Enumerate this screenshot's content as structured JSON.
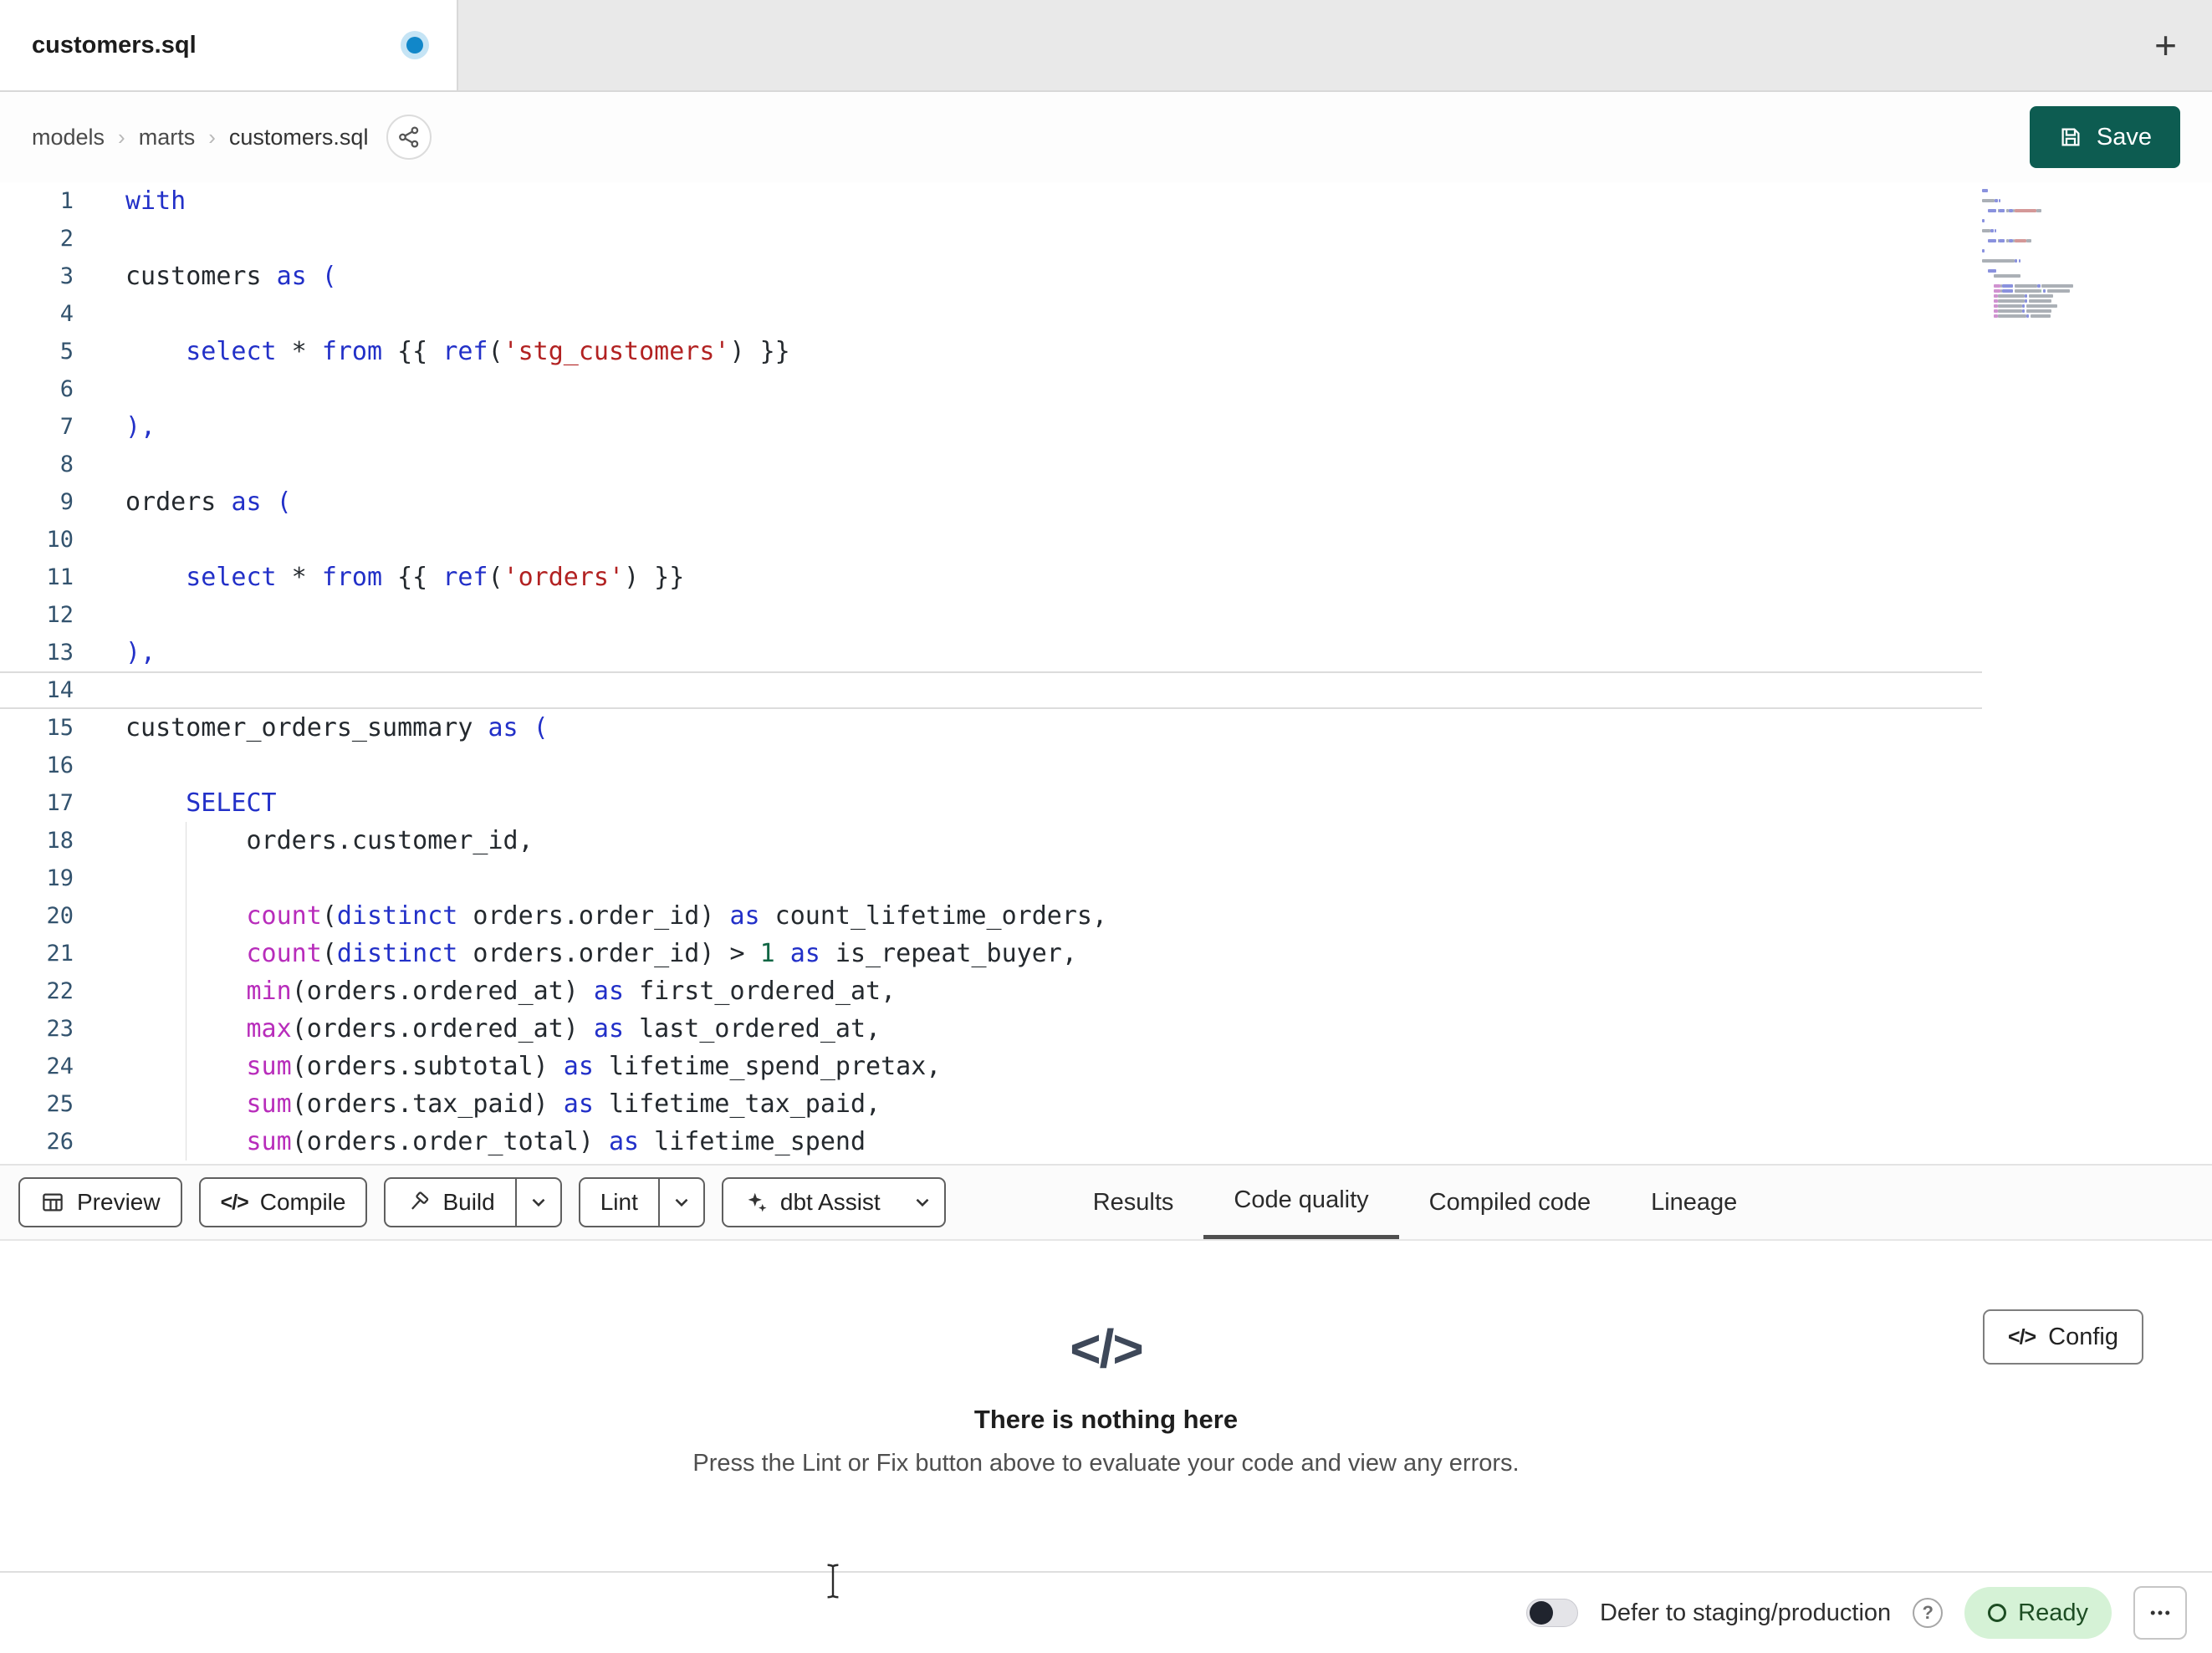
{
  "window": {
    "new_tab_label": "+"
  },
  "tab": {
    "title": "customers.sql",
    "modified": true
  },
  "breadcrumb": {
    "items": [
      "models",
      "marts",
      "customers.sql"
    ],
    "separator": "›"
  },
  "save_button": {
    "label": "Save"
  },
  "colors": {
    "accent": "#0d5c51",
    "keyword": "#2230c8",
    "function": "#b82dbb",
    "string": "#b22222",
    "number": "#116644",
    "text": "#24292e",
    "line_number": "#33536e",
    "ready_bg": "#d5f2d6",
    "ready_text": "#1d4d23"
  },
  "icons": {
    "code_glyph": "</>",
    "tab_modified": "blue-dot",
    "new_tab": "plus",
    "breadcrumb_action": "lineage-dag",
    "save": "floppy-disk",
    "preview": "table-grid",
    "compile": "code-brackets",
    "build": "hammer",
    "dropdown": "chevron-down",
    "dbt_assist": "sparkle",
    "config": "code-brackets",
    "help": "question-circle",
    "ready": "circle-outline",
    "more": "ellipsis",
    "cursor": "i-beam"
  },
  "editor": {
    "active_line": 14,
    "lines": [
      {
        "n": 1,
        "t": [
          [
            "kw",
            "with"
          ]
        ]
      },
      {
        "n": 2,
        "t": []
      },
      {
        "n": 3,
        "t": [
          [
            "tx",
            "customers "
          ],
          [
            "kw",
            "as"
          ],
          [
            "kw",
            " ("
          ]
        ]
      },
      {
        "n": 4,
        "t": []
      },
      {
        "n": 5,
        "t": [
          [
            "tx",
            "    "
          ],
          [
            "kw",
            "select"
          ],
          [
            "tx",
            " * "
          ],
          [
            "kw",
            "from"
          ],
          [
            "tx",
            " {{ "
          ],
          [
            "kw",
            "ref"
          ],
          [
            "tx",
            "("
          ],
          [
            "st",
            "'stg_customers'"
          ],
          [
            "tx",
            ") }}"
          ]
        ]
      },
      {
        "n": 6,
        "t": []
      },
      {
        "n": 7,
        "t": [
          [
            "kw",
            "),"
          ]
        ]
      },
      {
        "n": 8,
        "t": []
      },
      {
        "n": 9,
        "t": [
          [
            "tx",
            "orders "
          ],
          [
            "kw",
            "as"
          ],
          [
            "kw",
            " ("
          ]
        ]
      },
      {
        "n": 10,
        "t": []
      },
      {
        "n": 11,
        "t": [
          [
            "tx",
            "    "
          ],
          [
            "kw",
            "select"
          ],
          [
            "tx",
            " * "
          ],
          [
            "kw",
            "from"
          ],
          [
            "tx",
            " {{ "
          ],
          [
            "kw",
            "ref"
          ],
          [
            "tx",
            "("
          ],
          [
            "st",
            "'orders'"
          ],
          [
            "tx",
            ") }}"
          ]
        ]
      },
      {
        "n": 12,
        "t": []
      },
      {
        "n": 13,
        "t": [
          [
            "kw",
            "),"
          ]
        ]
      },
      {
        "n": 14,
        "t": []
      },
      {
        "n": 15,
        "t": [
          [
            "tx",
            "customer_orders_summary "
          ],
          [
            "kw",
            "as"
          ],
          [
            "kw",
            " ("
          ]
        ]
      },
      {
        "n": 16,
        "t": []
      },
      {
        "n": 17,
        "t": [
          [
            "tx",
            "    "
          ],
          [
            "kw",
            "SELECT"
          ]
        ]
      },
      {
        "n": 18,
        "t": [
          [
            "tx",
            "        orders.customer_id,"
          ]
        ]
      },
      {
        "n": 19,
        "t": []
      },
      {
        "n": 20,
        "t": [
          [
            "tx",
            "        "
          ],
          [
            "fn",
            "count"
          ],
          [
            "tx",
            "("
          ],
          [
            "kw",
            "distinct"
          ],
          [
            "tx",
            " orders.order_id) "
          ],
          [
            "kw",
            "as"
          ],
          [
            "tx",
            " count_lifetime_orders,"
          ]
        ]
      },
      {
        "n": 21,
        "t": [
          [
            "tx",
            "        "
          ],
          [
            "fn",
            "count"
          ],
          [
            "tx",
            "("
          ],
          [
            "kw",
            "distinct"
          ],
          [
            "tx",
            " orders.order_id) > "
          ],
          [
            "nm",
            "1"
          ],
          [
            "tx",
            " "
          ],
          [
            "kw",
            "as"
          ],
          [
            "tx",
            " is_repeat_buyer,"
          ]
        ]
      },
      {
        "n": 22,
        "t": [
          [
            "tx",
            "        "
          ],
          [
            "fn",
            "min"
          ],
          [
            "tx",
            "(orders.ordered_at) "
          ],
          [
            "kw",
            "as"
          ],
          [
            "tx",
            " first_ordered_at,"
          ]
        ]
      },
      {
        "n": 23,
        "t": [
          [
            "tx",
            "        "
          ],
          [
            "fn",
            "max"
          ],
          [
            "tx",
            "(orders.ordered_at) "
          ],
          [
            "kw",
            "as"
          ],
          [
            "tx",
            " last_ordered_at,"
          ]
        ]
      },
      {
        "n": 24,
        "t": [
          [
            "tx",
            "        "
          ],
          [
            "fn",
            "sum"
          ],
          [
            "tx",
            "(orders.subtotal) "
          ],
          [
            "kw",
            "as"
          ],
          [
            "tx",
            " lifetime_spend_pretax,"
          ]
        ]
      },
      {
        "n": 25,
        "t": [
          [
            "tx",
            "        "
          ],
          [
            "fn",
            "sum"
          ],
          [
            "tx",
            "(orders.tax_paid) "
          ],
          [
            "kw",
            "as"
          ],
          [
            "tx",
            " lifetime_tax_paid,"
          ]
        ]
      },
      {
        "n": 26,
        "t": [
          [
            "tx",
            "        "
          ],
          [
            "fn",
            "sum"
          ],
          [
            "tx",
            "(orders.order_total) "
          ],
          [
            "kw",
            "as"
          ],
          [
            "tx",
            " lifetime_spend"
          ]
        ]
      }
    ]
  },
  "toolbar": {
    "buttons": [
      {
        "id": "preview",
        "label": "Preview",
        "icon": "table-icon",
        "split": false,
        "dropdown": false
      },
      {
        "id": "compile",
        "label": "Compile",
        "icon": "code-icon",
        "split": false,
        "dropdown": false
      },
      {
        "id": "build",
        "label": "Build",
        "icon": "hammer-icon",
        "split": true,
        "dropdown": true
      },
      {
        "id": "lint",
        "label": "Lint",
        "icon": null,
        "split": true,
        "dropdown": true
      },
      {
        "id": "dbt-assist",
        "label": "dbt Assist",
        "icon": "sparkle-icon",
        "split": false,
        "dropdown": true
      }
    ],
    "tabs": [
      {
        "id": "results",
        "label": "Results",
        "active": false
      },
      {
        "id": "code-quality",
        "label": "Code quality",
        "active": true
      },
      {
        "id": "compiled-code",
        "label": "Compiled code",
        "active": false
      },
      {
        "id": "lineage",
        "label": "Lineage",
        "active": false
      }
    ]
  },
  "panel": {
    "title": "There is nothing here",
    "description": "Press the Lint or Fix button above to evaluate your code and view any errors.",
    "config_label": "Config"
  },
  "statusbar": {
    "defer_label": "Defer to staging/production",
    "help_label": "?",
    "ready_label": "Ready"
  }
}
